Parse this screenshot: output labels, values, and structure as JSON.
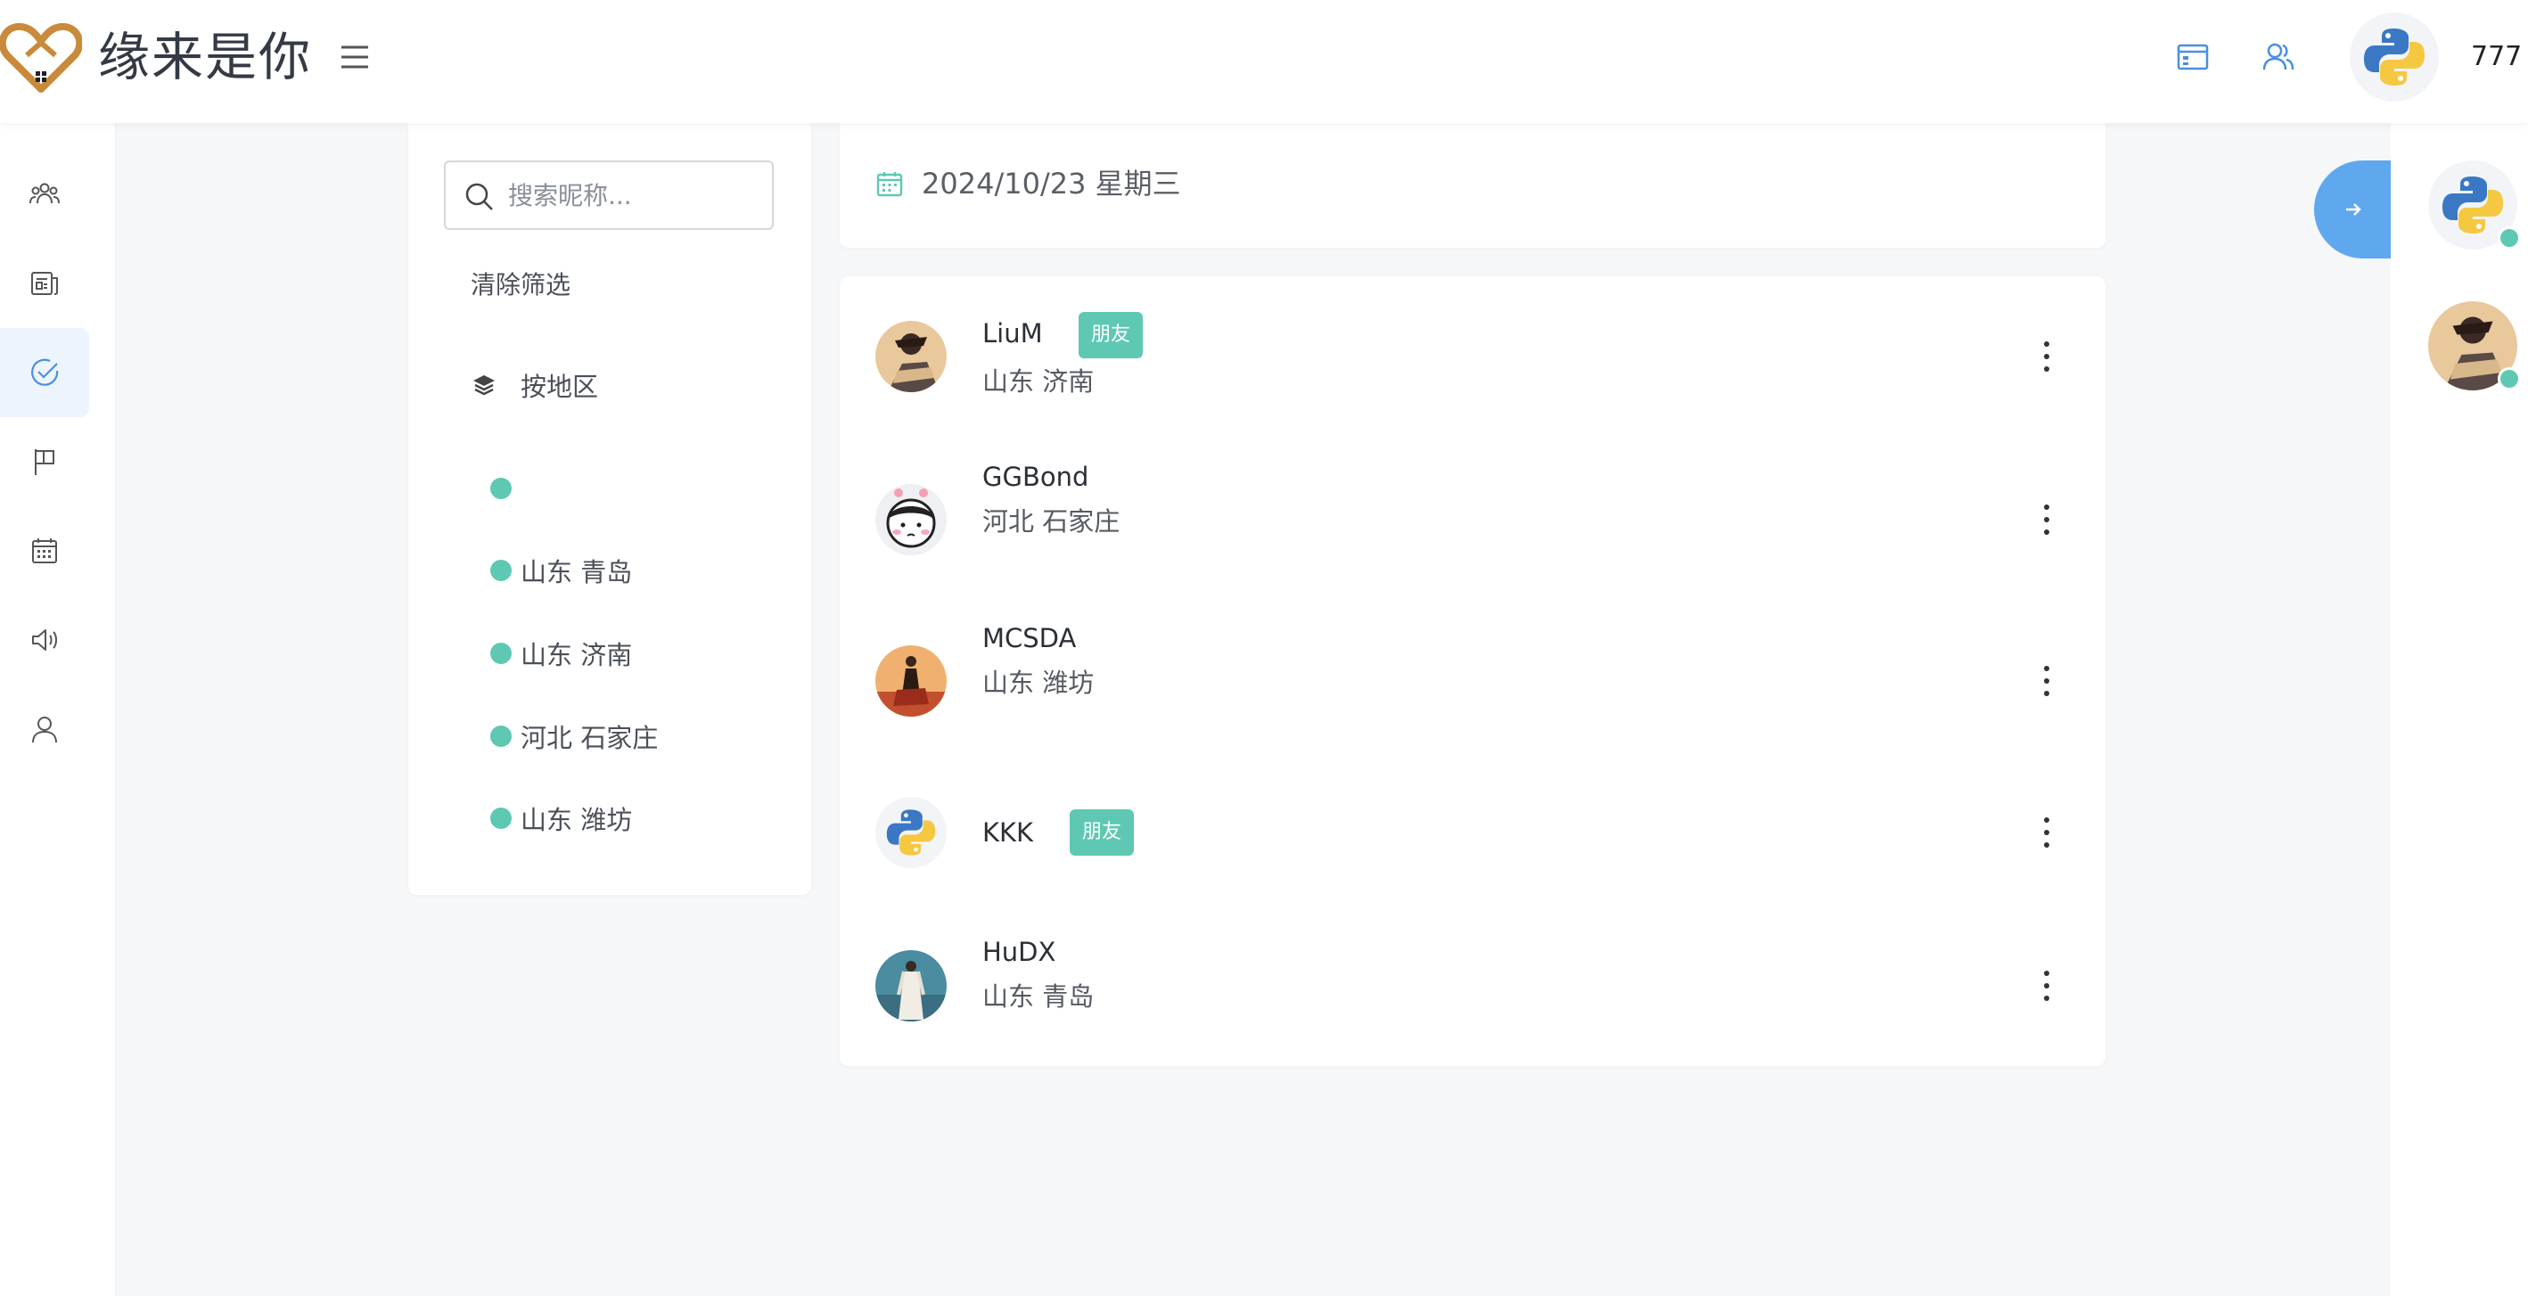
{
  "app": {
    "brand": "缘来是你"
  },
  "header": {
    "username": "777"
  },
  "sidebar": {
    "items": [
      {
        "icon": "group-icon"
      },
      {
        "icon": "news-icon"
      },
      {
        "icon": "check-circle-icon",
        "active": true
      },
      {
        "icon": "flag-icon"
      },
      {
        "icon": "calendar-icon"
      },
      {
        "icon": "speaker-icon"
      },
      {
        "icon": "user-icon"
      }
    ]
  },
  "filter": {
    "search_placeholder": "搜索昵称...",
    "search_value": "",
    "clear_label": "清除筛选",
    "region_heading": "按地区",
    "regions": [
      "",
      "山东 青岛",
      "山东 济南",
      "河北 石家庄",
      "山东 潍坊"
    ]
  },
  "date_bar": {
    "date": "2024/10/23 星期三"
  },
  "users": [
    {
      "name": "LiuM",
      "location": "山东 济南",
      "tag": "朋友"
    },
    {
      "name": "GGBond",
      "location": "河北 石家庄",
      "tag": ""
    },
    {
      "name": "MCSDA",
      "location": "山东 潍坊",
      "tag": ""
    },
    {
      "name": "KKK",
      "location": "",
      "tag": "朋友"
    },
    {
      "name": "HuDX",
      "location": "山东 青岛",
      "tag": ""
    }
  ],
  "colors": {
    "accent": "#5ec8b3",
    "primary": "#5fa8ee",
    "brand": "#c98a3b"
  }
}
